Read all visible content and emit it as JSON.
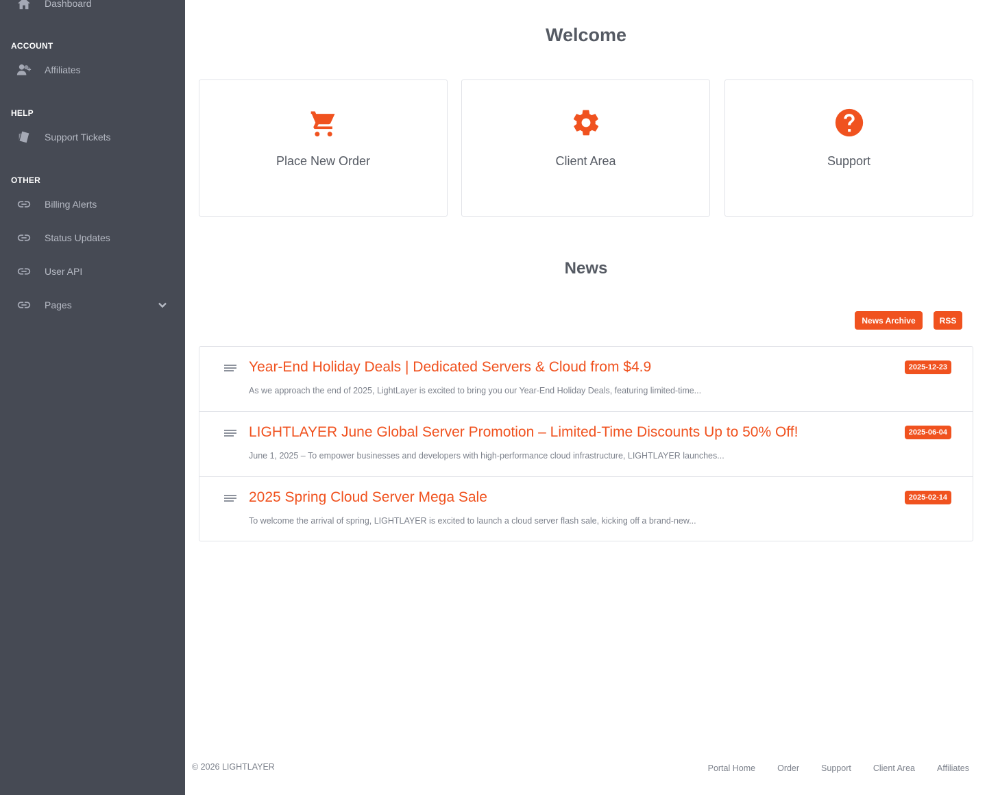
{
  "sidebar": {
    "dashboard_label": "Dashboard",
    "sections": {
      "account": "ACCOUNT",
      "help": "HELP",
      "other": "OTHER"
    },
    "items": {
      "affiliates": "Affiliates",
      "support_tickets": "Support Tickets",
      "billing_alerts": "Billing Alerts",
      "status_updates": "Status Updates",
      "user_api": "User API",
      "pages": "Pages"
    },
    "icons": [
      "home-icon",
      "user-plus-icon",
      "ticket-icon",
      "link-icon",
      "chevron-down-icon"
    ]
  },
  "welcome": {
    "title": "Welcome",
    "cards": [
      {
        "label": "Place New Order",
        "icon": "cart-icon"
      },
      {
        "label": "Client Area",
        "icon": "gear-icon"
      },
      {
        "label": "Support",
        "icon": "question-circle-icon"
      }
    ]
  },
  "news": {
    "title": "News",
    "archive_button": "News Archive",
    "rss_button": "RSS",
    "items": [
      {
        "title": "Year-End Holiday Deals | Dedicated Servers & Cloud from $4.9",
        "excerpt": "As we approach the end of 2025, LightLayer is excited to bring you our Year-End Holiday Deals, featuring limited-time...",
        "date": "2025-12-23"
      },
      {
        "title": "LIGHTLAYER June Global Server Promotion – Limited-Time Discounts Up to 50% Off!",
        "excerpt": "June 1, 2025 – To empower businesses and developers with high-performance cloud infrastructure, LIGHTLAYER launches...",
        "date": "2025-06-04"
      },
      {
        "title": "2025 Spring Cloud Server Mega Sale",
        "excerpt": "To welcome the arrival of spring, LIGHTLAYER is excited to launch a cloud server flash sale, kicking off a brand-new...",
        "date": "2025-02-14"
      }
    ]
  },
  "footer": {
    "copyright": "© 2026 LIGHTLAYER",
    "links": [
      "Portal Home",
      "Order",
      "Support",
      "Client Area",
      "Affiliates"
    ]
  },
  "colors": {
    "accent": "#f0521f",
    "sidebar_bg": "#464a54",
    "text": "#555a63"
  }
}
